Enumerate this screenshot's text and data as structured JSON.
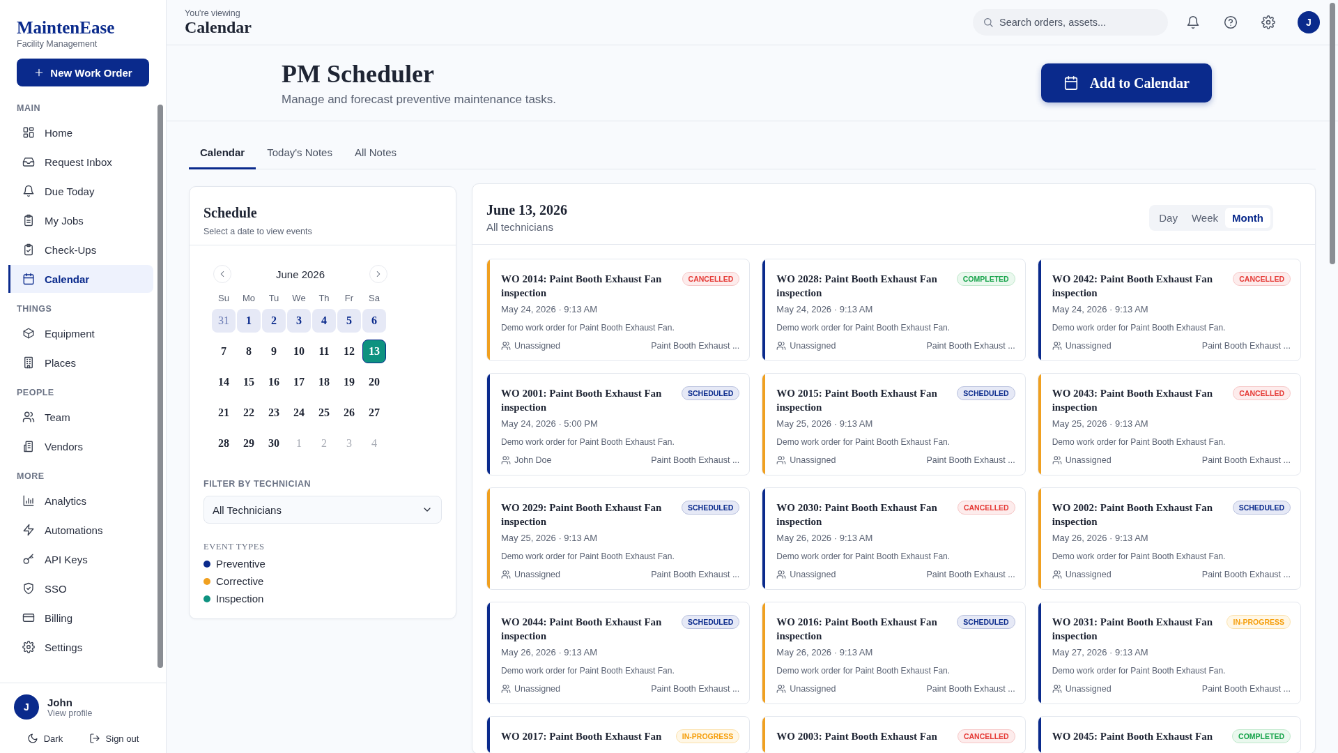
{
  "brand": {
    "name": "MaintenEase",
    "tagline": "Facility Management"
  },
  "new_button": "New Work Order",
  "sidebar": {
    "sections": [
      {
        "label": "MAIN",
        "items": [
          {
            "label": "Home",
            "selected": false
          },
          {
            "label": "Request Inbox",
            "selected": false
          },
          {
            "label": "Due Today",
            "selected": false
          },
          {
            "label": "My Jobs",
            "selected": false
          },
          {
            "label": "Check-Ups",
            "selected": false
          },
          {
            "label": "Calendar",
            "selected": true
          }
        ]
      },
      {
        "label": "THINGS",
        "items": [
          {
            "label": "Equipment",
            "selected": false
          },
          {
            "label": "Places",
            "selected": false
          }
        ]
      },
      {
        "label": "PEOPLE",
        "items": [
          {
            "label": "Team",
            "selected": false
          },
          {
            "label": "Vendors",
            "selected": false
          }
        ]
      },
      {
        "label": "MORE",
        "items": [
          {
            "label": "Analytics",
            "selected": false
          },
          {
            "label": "Automations",
            "selected": false
          },
          {
            "label": "API Keys",
            "selected": false
          },
          {
            "label": "SSO",
            "selected": false
          },
          {
            "label": "Billing",
            "selected": false
          },
          {
            "label": "Settings",
            "selected": false
          }
        ]
      }
    ],
    "user": {
      "initial": "J",
      "name": "John",
      "link": "View profile"
    },
    "footer": [
      "Dark",
      "Sign out"
    ]
  },
  "topbar": {
    "eyebrow": "You're viewing",
    "title": "Calendar",
    "search_placeholder": "Search orders, assets...",
    "avatar": "J"
  },
  "page": {
    "title": "PM Scheduler",
    "subtitle": "Manage and forecast preventive maintenance tasks.",
    "action": "Add to Calendar"
  },
  "tabs": [
    {
      "label": "Calendar",
      "selected": true
    },
    {
      "label": "Today's Notes",
      "selected": false
    },
    {
      "label": "All Notes",
      "selected": false
    }
  ],
  "schedule": {
    "title": "Schedule",
    "subtitle": "Select a date to view events",
    "month": "June 2026",
    "weekdays": [
      "Su",
      "Mo",
      "Tu",
      "We",
      "Th",
      "Fr",
      "Sa"
    ],
    "days": [
      {
        "label": "31",
        "outside": true,
        "highlighted": true,
        "selected": false
      },
      {
        "label": "1",
        "outside": false,
        "highlighted": true,
        "selected": false
      },
      {
        "label": "2",
        "outside": false,
        "highlighted": true,
        "selected": false
      },
      {
        "label": "3",
        "outside": false,
        "highlighted": true,
        "selected": false
      },
      {
        "label": "4",
        "outside": false,
        "highlighted": true,
        "selected": false
      },
      {
        "label": "5",
        "outside": false,
        "highlighted": true,
        "selected": false
      },
      {
        "label": "6",
        "outside": false,
        "highlighted": true,
        "selected": false
      },
      {
        "label": "7",
        "outside": false,
        "highlighted": false,
        "selected": false
      },
      {
        "label": "8",
        "outside": false,
        "highlighted": false,
        "selected": false
      },
      {
        "label": "9",
        "outside": false,
        "highlighted": false,
        "selected": false
      },
      {
        "label": "10",
        "outside": false,
        "highlighted": false,
        "selected": false
      },
      {
        "label": "11",
        "outside": false,
        "highlighted": false,
        "selected": false
      },
      {
        "label": "12",
        "outside": false,
        "highlighted": false,
        "selected": false
      },
      {
        "label": "13",
        "outside": false,
        "highlighted": false,
        "selected": true
      },
      {
        "label": "14",
        "outside": false,
        "highlighted": false,
        "selected": false
      },
      {
        "label": "15",
        "outside": false,
        "highlighted": false,
        "selected": false
      },
      {
        "label": "16",
        "outside": false,
        "highlighted": false,
        "selected": false
      },
      {
        "label": "17",
        "outside": false,
        "highlighted": false,
        "selected": false
      },
      {
        "label": "18",
        "outside": false,
        "highlighted": false,
        "selected": false
      },
      {
        "label": "19",
        "outside": false,
        "highlighted": false,
        "selected": false
      },
      {
        "label": "20",
        "outside": false,
        "highlighted": false,
        "selected": false
      },
      {
        "label": "21",
        "outside": false,
        "highlighted": false,
        "selected": false
      },
      {
        "label": "22",
        "outside": false,
        "highlighted": false,
        "selected": false
      },
      {
        "label": "23",
        "outside": false,
        "highlighted": false,
        "selected": false
      },
      {
        "label": "24",
        "outside": false,
        "highlighted": false,
        "selected": false
      },
      {
        "label": "25",
        "outside": false,
        "highlighted": false,
        "selected": false
      },
      {
        "label": "26",
        "outside": false,
        "highlighted": false,
        "selected": false
      },
      {
        "label": "27",
        "outside": false,
        "highlighted": false,
        "selected": false
      },
      {
        "label": "28",
        "outside": false,
        "highlighted": false,
        "selected": false
      },
      {
        "label": "29",
        "outside": false,
        "highlighted": false,
        "selected": false
      },
      {
        "label": "30",
        "outside": false,
        "highlighted": false,
        "selected": false
      },
      {
        "label": "1",
        "outside": true,
        "highlighted": false,
        "selected": false
      },
      {
        "label": "2",
        "outside": true,
        "highlighted": false,
        "selected": false
      },
      {
        "label": "3",
        "outside": true,
        "highlighted": false,
        "selected": false
      },
      {
        "label": "4",
        "outside": true,
        "highlighted": false,
        "selected": false
      }
    ],
    "filter_label": "FILTER BY TECHNICIAN",
    "filter_value": "All Technicians",
    "legend_title": "EVENT TYPES",
    "legend": [
      {
        "label": "Preventive",
        "color": "#0a2a8c"
      },
      {
        "label": "Corrective",
        "color": "#f0a020"
      },
      {
        "label": "Inspection",
        "color": "#0e9280"
      }
    ]
  },
  "events": {
    "date": "June 13, 2026",
    "scope": "All technicians",
    "views": [
      {
        "label": "Day",
        "selected": false
      },
      {
        "label": "Week",
        "selected": false
      },
      {
        "label": "Month",
        "selected": true
      }
    ],
    "cards": [
      {
        "title": "WO 2014: Paint Booth Exhaust Fan inspection",
        "color": "#f0a020",
        "kind": "cancelled",
        "badge": "CANCELLED",
        "when": "May 24, 2026 · 9:13 AM",
        "desc": "Demo work order for Paint Booth Exhaust Fan.",
        "assignee": "Unassigned",
        "asset": "Paint Booth Exhaust ..."
      },
      {
        "title": "WO 2028: Paint Booth Exhaust Fan inspection",
        "color": "#0a2a8c",
        "kind": "completed",
        "badge": "COMPLETED",
        "when": "May 24, 2026 · 9:13 AM",
        "desc": "Demo work order for Paint Booth Exhaust Fan.",
        "assignee": "Unassigned",
        "asset": "Paint Booth Exhaust ..."
      },
      {
        "title": "WO 2042: Paint Booth Exhaust Fan inspection",
        "color": "#0a2a8c",
        "kind": "cancelled",
        "badge": "CANCELLED",
        "when": "May 24, 2026 · 9:13 AM",
        "desc": "Demo work order for Paint Booth Exhaust Fan.",
        "assignee": "Unassigned",
        "asset": "Paint Booth Exhaust ..."
      },
      {
        "title": "WO 2001: Paint Booth Exhaust Fan inspection",
        "color": "#0a2a8c",
        "kind": "scheduled",
        "badge": "SCHEDULED",
        "when": "May 24, 2026 · 5:00 PM",
        "desc": "Demo work order for Paint Booth Exhaust Fan.",
        "assignee": "John Doe",
        "asset": "Paint Booth Exhaust ..."
      },
      {
        "title": "WO 2015: Paint Booth Exhaust Fan inspection",
        "color": "#f0a020",
        "kind": "scheduled",
        "badge": "SCHEDULED",
        "when": "May 25, 2026 · 9:13 AM",
        "desc": "Demo work order for Paint Booth Exhaust Fan.",
        "assignee": "Unassigned",
        "asset": "Paint Booth Exhaust ..."
      },
      {
        "title": "WO 2043: Paint Booth Exhaust Fan inspection",
        "color": "#f0a020",
        "kind": "cancelled",
        "badge": "CANCELLED",
        "when": "May 25, 2026 · 9:13 AM",
        "desc": "Demo work order for Paint Booth Exhaust Fan.",
        "assignee": "Unassigned",
        "asset": "Paint Booth Exhaust ..."
      },
      {
        "title": "WO 2029: Paint Booth Exhaust Fan inspection",
        "color": "#f0a020",
        "kind": "scheduled",
        "badge": "SCHEDULED",
        "when": "May 25, 2026 · 9:13 AM",
        "desc": "Demo work order for Paint Booth Exhaust Fan.",
        "assignee": "Unassigned",
        "asset": "Paint Booth Exhaust ..."
      },
      {
        "title": "WO 2030: Paint Booth Exhaust Fan inspection",
        "color": "#0a2a8c",
        "kind": "cancelled",
        "badge": "CANCELLED",
        "when": "May 26, 2026 · 9:13 AM",
        "desc": "Demo work order for Paint Booth Exhaust Fan.",
        "assignee": "Unassigned",
        "asset": "Paint Booth Exhaust ..."
      },
      {
        "title": "WO 2002: Paint Booth Exhaust Fan inspection",
        "color": "#f0a020",
        "kind": "scheduled",
        "badge": "SCHEDULED",
        "when": "May 26, 2026 · 9:13 AM",
        "desc": "Demo work order for Paint Booth Exhaust Fan.",
        "assignee": "Unassigned",
        "asset": "Paint Booth Exhaust ..."
      },
      {
        "title": "WO 2044: Paint Booth Exhaust Fan inspection",
        "color": "#0a2a8c",
        "kind": "scheduled",
        "badge": "SCHEDULED",
        "when": "May 26, 2026 · 9:13 AM",
        "desc": "Demo work order for Paint Booth Exhaust Fan.",
        "assignee": "Unassigned",
        "asset": "Paint Booth Exhaust ..."
      },
      {
        "title": "WO 2016: Paint Booth Exhaust Fan inspection",
        "color": "#f0a020",
        "kind": "scheduled",
        "badge": "SCHEDULED",
        "when": "May 26, 2026 · 9:13 AM",
        "desc": "Demo work order for Paint Booth Exhaust Fan.",
        "assignee": "Unassigned",
        "asset": "Paint Booth Exhaust ..."
      },
      {
        "title": "WO 2031: Paint Booth Exhaust Fan inspection",
        "color": "#0a2a8c",
        "kind": "in-progress",
        "badge": "IN-PROGRESS",
        "when": "May 27, 2026 · 9:13 AM",
        "desc": "Demo work order for Paint Booth Exhaust Fan.",
        "assignee": "Unassigned",
        "asset": "Paint Booth Exhaust ..."
      },
      {
        "title": "WO 2017: Paint Booth Exhaust Fan",
        "color": "#0a2a8c",
        "kind": "in-progress",
        "badge": "IN-PROGRESS"
      },
      {
        "title": "WO 2003: Paint Booth Exhaust Fan",
        "color": "#f0a020",
        "kind": "cancelled",
        "badge": "CANCELLED"
      },
      {
        "title": "WO 2045: Paint Booth Exhaust Fan",
        "color": "#0a2a8c",
        "kind": "completed",
        "badge": "COMPLETED"
      }
    ]
  }
}
